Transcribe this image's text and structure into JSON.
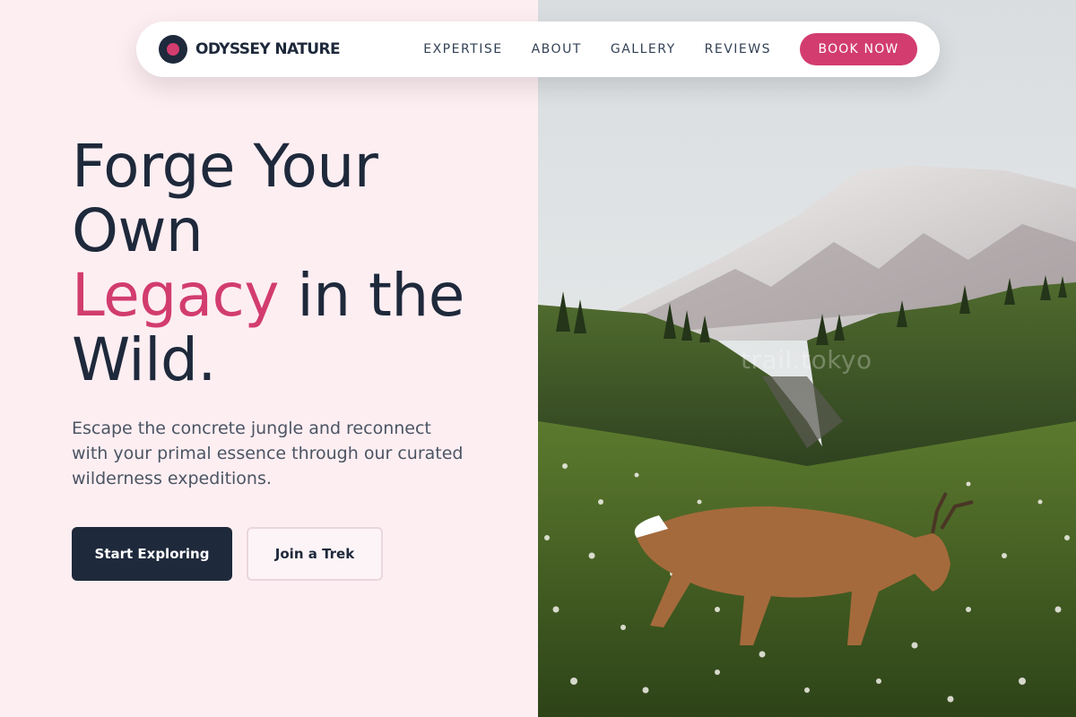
{
  "brand": {
    "logo_icon": "circle-dot-logo-icon",
    "name": "ODYSSEY NATURE",
    "colors": {
      "dark": "#1e293b",
      "accent": "#d23c6e"
    }
  },
  "nav": {
    "links": [
      "EXPERTISE",
      "ABOUT",
      "GALLERY",
      "REVIEWS"
    ],
    "cta_label": "BOOK NOW"
  },
  "hero": {
    "headline_part1": "Forge Your Own",
    "headline_accent": "Legacy",
    "headline_part2": "in the Wild.",
    "subtitle": "Escape the concrete jungle and reconnect with your primal essence through our curated wilderness expeditions.",
    "primary_cta": "Start Exploring",
    "secondary_cta": "Join a Trek",
    "background_color": "#fdeef2"
  },
  "image": {
    "watermark": "trail.tokyo"
  }
}
